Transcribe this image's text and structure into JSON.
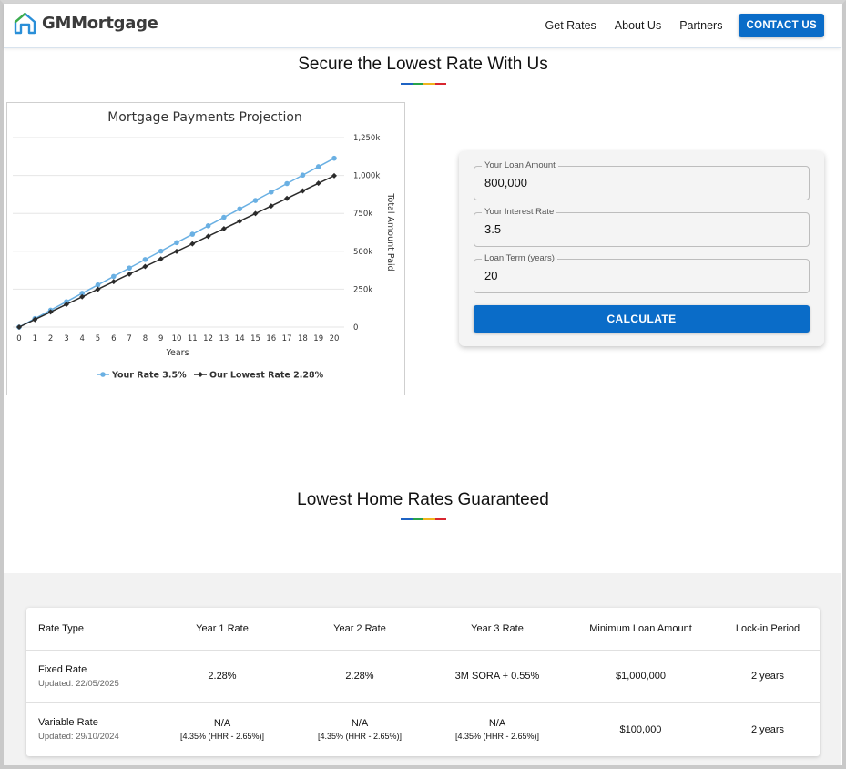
{
  "header": {
    "brand": "GMMortgage",
    "nav": [
      "Get Rates",
      "About Us",
      "Partners"
    ],
    "contact_label": "CONTACT US"
  },
  "section1": {
    "title": "Secure the Lowest Rate With Us"
  },
  "section2": {
    "title": "Lowest Home Rates Guaranteed"
  },
  "title_bar_colors": [
    "#1e63c4",
    "#27a34a",
    "#f0b41c",
    "#d8262f"
  ],
  "chart_data": {
    "type": "line",
    "title": "Mortgage Payments Projection",
    "xlabel": "Years",
    "ylabel": "Total Amount Paid",
    "x": [
      0,
      1,
      2,
      3,
      4,
      5,
      6,
      7,
      8,
      9,
      10,
      11,
      12,
      13,
      14,
      15,
      16,
      17,
      18,
      19,
      20
    ],
    "ylim": [
      0,
      1250000
    ],
    "yticks": [
      0,
      250000,
      500000,
      750000,
      1000000,
      1250000
    ],
    "ytick_labels": [
      "0",
      "250k",
      "500k",
      "750k",
      "1,000k",
      "1,250k"
    ],
    "grid": true,
    "legend_position": "bottom",
    "series": [
      {
        "name": "Your Rate 3.5%",
        "color": "#6ab0e3",
        "marker": "circle",
        "values": [
          0,
          55680,
          111360,
          167040,
          222720,
          278400,
          334080,
          389760,
          445440,
          501120,
          556800,
          612480,
          668160,
          723840,
          779520,
          835200,
          890880,
          946560,
          1002240,
          1057920,
          1113600
        ]
      },
      {
        "name": "Our Lowest Rate 2.28%",
        "color": "#2b2b2b",
        "marker": "diamond",
        "values": [
          0,
          49920,
          99840,
          149760,
          199680,
          249600,
          299520,
          349440,
          399360,
          449280,
          499200,
          549120,
          599040,
          648960,
          698880,
          748800,
          798720,
          848640,
          898560,
          948480,
          998400
        ]
      }
    ]
  },
  "calculator": {
    "loan_amount_label": "Your Loan Amount",
    "loan_amount_value": "800,000",
    "interest_rate_label": "Your Interest Rate",
    "interest_rate_value": "3.5",
    "loan_term_label": "Loan Term (years)",
    "loan_term_value": "20",
    "calculate_label": "CALCULATE"
  },
  "rates_table": {
    "headers": [
      "Rate Type",
      "Year 1 Rate",
      "Year 2 Rate",
      "Year 3 Rate",
      "Minimum Loan Amount",
      "Lock-in Period"
    ],
    "rows": [
      {
        "type": "Fixed Rate",
        "updated": "Updated: 22/05/2025",
        "year1": "2.28%",
        "year1_sub": "",
        "year2": "2.28%",
        "year2_sub": "",
        "year3": "3M SORA + 0.55%",
        "year3_sub": "",
        "min_loan": "$1,000,000",
        "lock_in": "2 years"
      },
      {
        "type": "Variable Rate",
        "updated": "Updated: 29/10/2024",
        "year1": "N/A",
        "year1_sub": "[4.35% (HHR - 2.65%)]",
        "year2": "N/A",
        "year2_sub": "[4.35% (HHR - 2.65%)]",
        "year3": "N/A",
        "year3_sub": "[4.35% (HHR - 2.65%)]",
        "min_loan": "$100,000",
        "lock_in": "2 years"
      }
    ]
  }
}
